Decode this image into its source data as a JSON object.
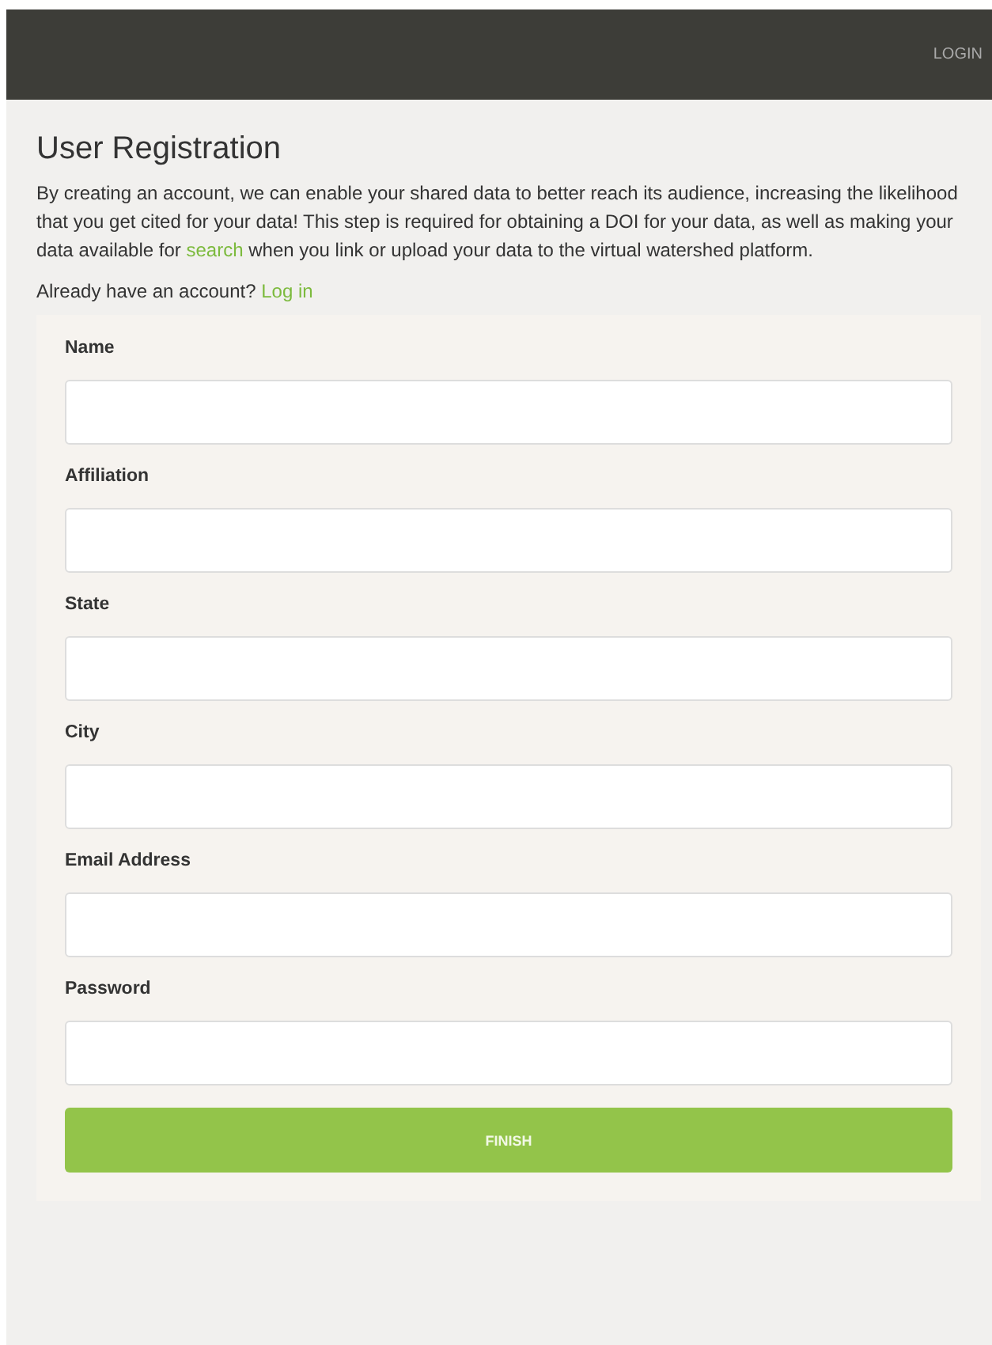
{
  "header": {
    "login": "LOGIN"
  },
  "title": "User Registration",
  "intro": {
    "before": "By creating an account, we can enable your shared data to better reach its audience, increasing the likelihood that you get cited for your data! This step is required for obtaining a DOI for your data, as well as making your data available for ",
    "link": "search",
    "after": " when you link or upload your data to the virtual watershed platform."
  },
  "account": {
    "text": "Already have an account?",
    "link": "Log in"
  },
  "fields": [
    {
      "label": "Name"
    },
    {
      "label": "Affiliation"
    },
    {
      "label": "State"
    },
    {
      "label": "City"
    },
    {
      "label": "Email Address"
    },
    {
      "label": "Password"
    }
  ],
  "submit": "FINISH"
}
